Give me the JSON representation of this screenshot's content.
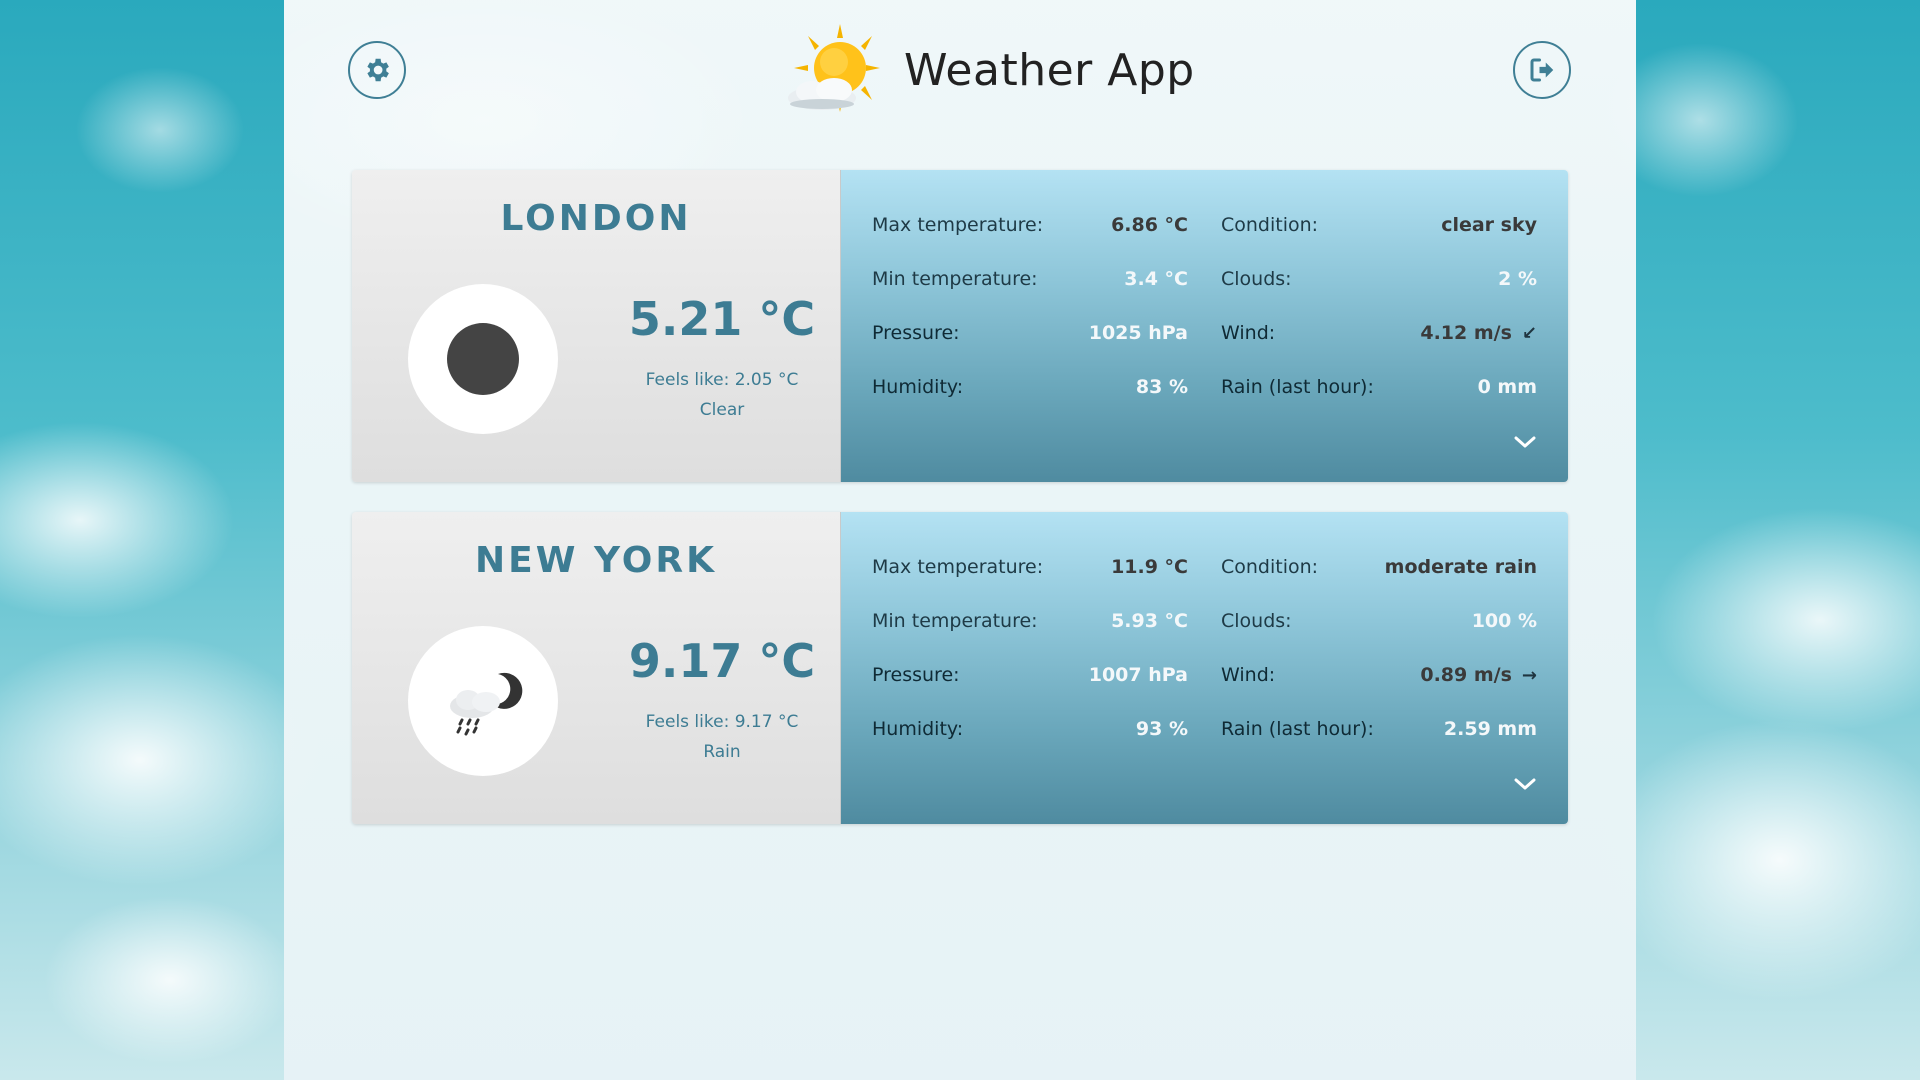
{
  "header": {
    "title": "Weather App",
    "settings_icon": "gear-icon",
    "logout_icon": "sign-out-icon",
    "logo_icon": "sun-behind-cloud-icon"
  },
  "cities": [
    {
      "name": "London",
      "icon": "moon-clear-night-icon",
      "temp": "5.21 °C",
      "feels_like": "Feels like: 2.05 °C",
      "condition_short": "Clear",
      "details": {
        "max_temp_label": "Max temperature:",
        "max_temp": "6.86 °C",
        "min_temp_label": "Min temperature:",
        "min_temp": "3.4 °C",
        "pressure_label": "Pressure:",
        "pressure": "1025 hPa",
        "humidity_label": "Humidity:",
        "humidity": "83 %",
        "condition_label": "Condition:",
        "condition": "clear sky",
        "clouds_label": "Clouds:",
        "clouds": "2 %",
        "wind_label": "Wind:",
        "wind": "4.12 m/s",
        "wind_arrow": "↙",
        "rain_label": "Rain (last hour):",
        "rain": "0 mm"
      }
    },
    {
      "name": "New York",
      "icon": "rain-cloud-night-icon",
      "temp": "9.17 °C",
      "feels_like": "Feels like: 9.17 °C",
      "condition_short": "Rain",
      "details": {
        "max_temp_label": "Max temperature:",
        "max_temp": "11.9 °C",
        "min_temp_label": "Min temperature:",
        "min_temp": "5.93 °C",
        "pressure_label": "Pressure:",
        "pressure": "1007 hPa",
        "humidity_label": "Humidity:",
        "humidity": "93 %",
        "condition_label": "Condition:",
        "condition": "moderate rain",
        "clouds_label": "Clouds:",
        "clouds": "100 %",
        "wind_label": "Wind:",
        "wind": "0.89 m/s",
        "wind_arrow": "→",
        "rain_label": "Rain (last hour):",
        "rain": "2.59 mm"
      }
    }
  ],
  "colors": {
    "accent": "#3d7c93",
    "panel_bg": "#f2f8f9",
    "detail_gradient_top": "#b4e2f3",
    "detail_gradient_bottom": "#4f8ba0"
  }
}
